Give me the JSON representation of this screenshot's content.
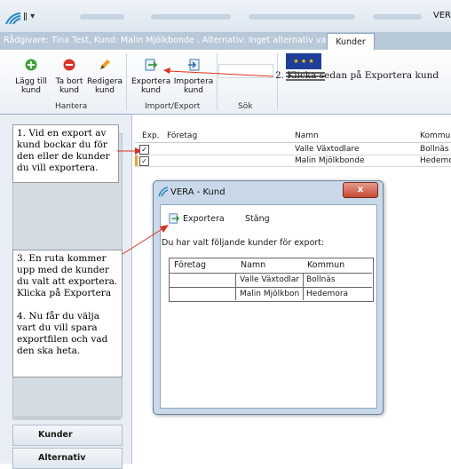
{
  "app": {
    "title": "VER",
    "qat": "ǁ ▾"
  },
  "context": {
    "text": "Rådgivare: Tina Test, Kund:   Malin Mjölkbonde , Alternativ: Inget alternativ valt",
    "tab": "Kunder"
  },
  "ribbon": {
    "buttons": {
      "add": "Lägg till kund",
      "remove": "Ta bort kund",
      "edit": "Redigera kund",
      "export": "Exportera kund",
      "import": "Importera kund"
    },
    "groups": {
      "manage": "Hantera",
      "import_export": "Import/Export",
      "search": "Sök"
    }
  },
  "annotations": {
    "step1": "1. Vid en export av kund bockar du för den eller de kunder du vill exportera.",
    "step2": "2. Klicka sedan på Exportera kund",
    "step3": "3. En ruta kommer upp med de kunder du valt att exportera. Klicka på Exportera",
    "step4": "4. Nu får du välja vart du vill spara exportfilen och vad den ska heta."
  },
  "grid": {
    "headers": {
      "exp": "Exp.",
      "company": "Företag",
      "name": "Namn",
      "municipality": "Kommun"
    },
    "rows": [
      {
        "checked": "✓",
        "company": "",
        "name": "Valle Växtodlare",
        "municipality": "Bollnäs"
      },
      {
        "checked": "✓",
        "company": "",
        "name": "Malin Mjölkbonde",
        "municipality": "Hedemora"
      }
    ]
  },
  "dialog": {
    "title": "VERA - Kund",
    "close": "x",
    "export_btn": "Exportera",
    "close_btn": "Stäng",
    "prompt": "Du har valt följande kunder för export:",
    "headers": {
      "company": "Företag",
      "name": "Namn",
      "municipality": "Kommun"
    },
    "rows": [
      {
        "company": "",
        "name": "Valle Växtodlar",
        "municipality": "Bollnäs"
      },
      {
        "company": "",
        "name": "Malin Mjölkbon",
        "municipality": "Hedemora"
      }
    ]
  },
  "nav": {
    "customers": "Kunder",
    "alternatives": "Alternativ"
  },
  "colors": {
    "accent": "#1f6fd1",
    "arrow": "#e0301e"
  }
}
